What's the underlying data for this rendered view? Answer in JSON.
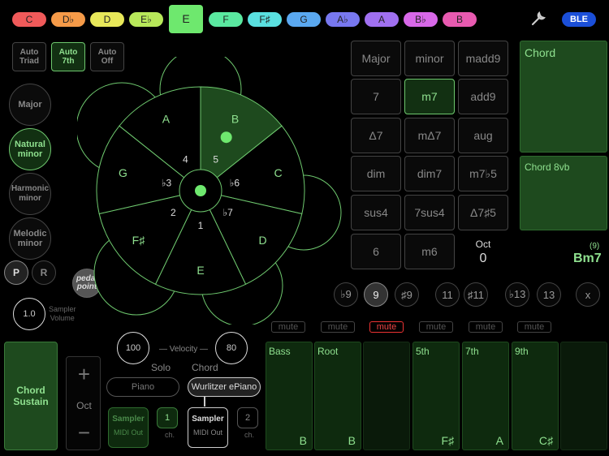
{
  "keys": [
    {
      "label": "C",
      "color": "#f05a5a"
    },
    {
      "label": "D♭",
      "color": "#f59a48"
    },
    {
      "label": "D",
      "color": "#e8e85a"
    },
    {
      "label": "E♭",
      "color": "#b8e85a"
    },
    {
      "label": "E",
      "color": "#6ee86e",
      "selected": true
    },
    {
      "label": "F",
      "color": "#5ae8a0"
    },
    {
      "label": "F♯",
      "color": "#5ae0e0"
    },
    {
      "label": "G",
      "color": "#5aa8f0"
    },
    {
      "label": "A♭",
      "color": "#7878f0"
    },
    {
      "label": "A",
      "color": "#a070f0"
    },
    {
      "label": "B♭",
      "color": "#d868e8"
    },
    {
      "label": "B",
      "color": "#e85ab0"
    }
  ],
  "header": {
    "ble": "BLE"
  },
  "auto": {
    "triad": "Auto\nTriad",
    "seventh": "Auto\n7th",
    "off": "Auto\nOff"
  },
  "scales": {
    "major": "Major",
    "natural": "Natural\nminor",
    "harmonic": "Harmonic\nminor",
    "melodic": "Melodic\nminor"
  },
  "pr": {
    "p": "P",
    "r": "R"
  },
  "pedal": "pedal\npoint",
  "sampler": {
    "volume": "1.0",
    "label": "Sampler\nVolume"
  },
  "wheel": {
    "notes": [
      "B",
      "C",
      "D",
      "E",
      "F♯",
      "G",
      "A"
    ],
    "degrees": [
      "5",
      "♭6",
      "♭7",
      "1",
      "2",
      "♭3",
      "4"
    ]
  },
  "chord_types": [
    "Major",
    "minor",
    "madd9",
    "7",
    "m7",
    "add9",
    "Δ7",
    "mΔ7",
    "aug",
    "dim",
    "dim7",
    "m7♭5",
    "sus4",
    "7sus4",
    "Δ7♯5",
    "6",
    "m6"
  ],
  "selected_type": "m7",
  "oct": {
    "label": "Oct",
    "value": "0"
  },
  "panels": {
    "chord": "Chord",
    "chord8vb": "Chord 8vb"
  },
  "chord_name": {
    "name": "Bm7",
    "ext": "(9)"
  },
  "extensions": [
    "♭9",
    "9",
    "♯9",
    "11",
    "♯11",
    "♭13",
    "13",
    "x"
  ],
  "selected_ext": "9",
  "mutes": [
    "mute",
    "mute",
    "mute",
    "mute",
    "mute",
    "mute"
  ],
  "chord_sustain": "Chord\nSustain",
  "octave": {
    "plus": "+",
    "label": "Oct",
    "minus": "−"
  },
  "velocity": {
    "left": "100",
    "label": "Velocity",
    "right": "80"
  },
  "solo": {
    "title": "Solo",
    "instrument": "Piano",
    "sampler": "Sampler",
    "midi": "MIDI Out",
    "ch": "1",
    "ch_label": "ch."
  },
  "chord": {
    "title": "Chord",
    "instrument": "Wurlitzer ePiano",
    "sampler": "Sampler",
    "midi": "MIDI Out",
    "ch": "2",
    "ch_label": "ch."
  },
  "voices": [
    {
      "label": "Bass",
      "note": "B"
    },
    {
      "label": "Root",
      "note": "B"
    },
    {
      "label": "",
      "note": ""
    },
    {
      "label": "5th",
      "note": "F♯"
    },
    {
      "label": "7th",
      "note": "A"
    },
    {
      "label": "9th",
      "note": "C♯"
    },
    {
      "label": "",
      "note": ""
    }
  ]
}
